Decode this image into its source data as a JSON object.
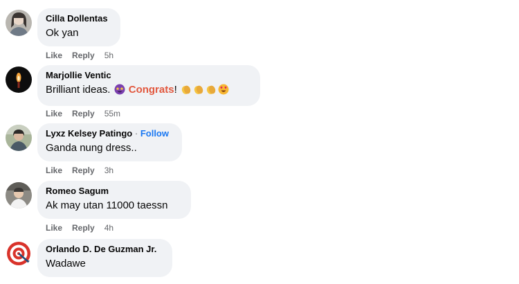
{
  "comments": [
    {
      "author": "Cilla Dollentas",
      "text": "Ok yan",
      "like": "Like",
      "reply": "Reply",
      "time": "5h",
      "avatar_icon": "person-photo"
    },
    {
      "author": "Marjollie Ventic",
      "text_before": "Brilliant ideas.",
      "emoji_1": "star-struck-emoji",
      "highlight": "Congrats",
      "text_after": "!",
      "emojis_end": [
        "clapping-hands-emoji",
        "clapping-hands-emoji",
        "clapping-hands-emoji",
        "heart-eyes-emoji"
      ],
      "like": "Like",
      "reply": "Reply",
      "time": "55m",
      "avatar_icon": "candle-photo"
    },
    {
      "author": "Lyxz Kelsey Patingo",
      "separator": "·",
      "follow": "Follow",
      "text": "Ganda nung dress..",
      "like": "Like",
      "reply": "Reply",
      "time": "3h",
      "avatar_icon": "person-photo"
    },
    {
      "author": "Romeo Sagum",
      "text": "Ak may utan 11000 taessn",
      "like": "Like",
      "reply": "Reply",
      "time": "4h",
      "avatar_icon": "person-photo"
    },
    {
      "author": "Orlando D. De Guzman Jr.",
      "text": "Wadawe",
      "avatar_icon": "target-photo"
    }
  ],
  "colors": {
    "bubble": "#f0f2f5",
    "meta": "#65676b",
    "link": "#1877f2",
    "congrats": "#e2583e"
  }
}
